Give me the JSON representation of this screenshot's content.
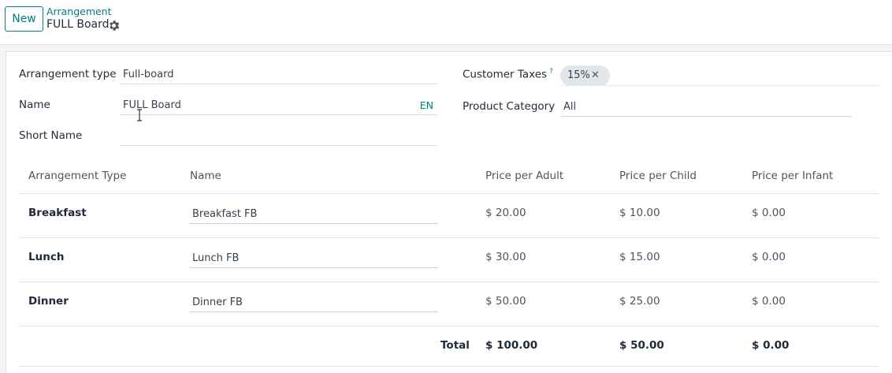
{
  "control_panel": {
    "new_button": "New",
    "breadcrumb": "Arrangement",
    "record_title": "FULL Board"
  },
  "form": {
    "arrangement_type": {
      "label": "Arrangement type",
      "value": "Full-board"
    },
    "name": {
      "label": "Name",
      "value": "FULL Board",
      "lang": "EN"
    },
    "short_name": {
      "label": "Short Name",
      "value": ""
    },
    "customer_taxes": {
      "label": "Customer Taxes",
      "help": "?",
      "tags": [
        "15%"
      ]
    },
    "product_category": {
      "label": "Product Category",
      "value": "All"
    }
  },
  "table": {
    "headers": [
      "Arrangement Type",
      "Name",
      "Price per Adult",
      "Price per Child",
      "Price per Infant"
    ],
    "rows": [
      {
        "type": "Breakfast",
        "name": "Breakfast FB",
        "adult": "$ 20.00",
        "child": "$ 10.00",
        "infant": "$ 0.00"
      },
      {
        "type": "Lunch",
        "name": "Lunch FB",
        "adult": "$ 30.00",
        "child": "$ 15.00",
        "infant": "$ 0.00"
      },
      {
        "type": "Dinner",
        "name": "Dinner FB",
        "adult": "$ 50.00",
        "child": "$ 25.00",
        "infant": "$ 0.00"
      }
    ],
    "total": {
      "label": "Total",
      "adult": "$ 100.00",
      "child": "$ 50.00",
      "infant": "$ 0.00"
    }
  }
}
